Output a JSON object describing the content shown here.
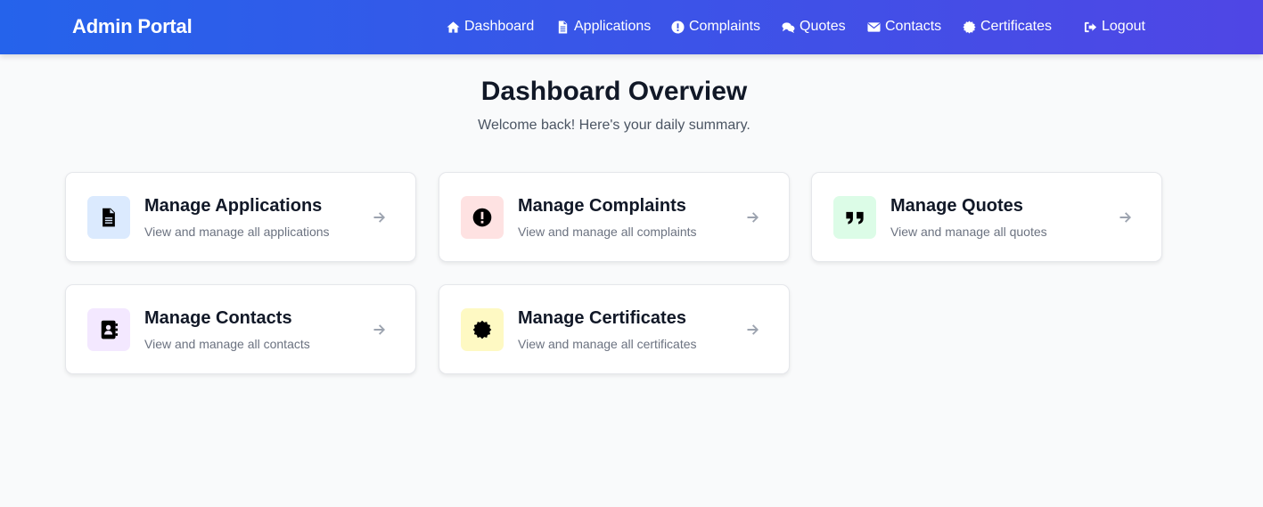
{
  "header": {
    "brand": "Admin Portal",
    "nav": [
      {
        "label": "Dashboard",
        "icon": "home-icon"
      },
      {
        "label": "Applications",
        "icon": "file-icon"
      },
      {
        "label": "Complaints",
        "icon": "exclamation-circle-icon"
      },
      {
        "label": "Quotes",
        "icon": "comments-icon"
      },
      {
        "label": "Contacts",
        "icon": "envelope-icon"
      },
      {
        "label": "Certificates",
        "icon": "certificate-icon"
      },
      {
        "label": "Logout",
        "icon": "sign-out-icon"
      }
    ],
    "colors": {
      "gradient_start": "#2563eb",
      "gradient_end": "#4f46e5"
    }
  },
  "main": {
    "title": "Dashboard Overview",
    "subtitle": "Welcome back! Here's your daily summary."
  },
  "cards": [
    {
      "title": "Manage Applications",
      "description": "View and manage all applications",
      "icon": "file-icon",
      "icon_bg": "#dbeafe"
    },
    {
      "title": "Manage Complaints",
      "description": "View and manage all complaints",
      "icon": "exclamation-circle-icon",
      "icon_bg": "#fee2e2"
    },
    {
      "title": "Manage Quotes",
      "description": "View and manage all quotes",
      "icon": "quote-icon",
      "icon_bg": "#dcfce7"
    },
    {
      "title": "Manage Contacts",
      "description": "View and manage all contacts",
      "icon": "address-book-icon",
      "icon_bg": "#f3e8ff"
    },
    {
      "title": "Manage Certificates",
      "description": "View and manage all certificates",
      "icon": "certificate-icon",
      "icon_bg": "#fef9c3"
    }
  ]
}
